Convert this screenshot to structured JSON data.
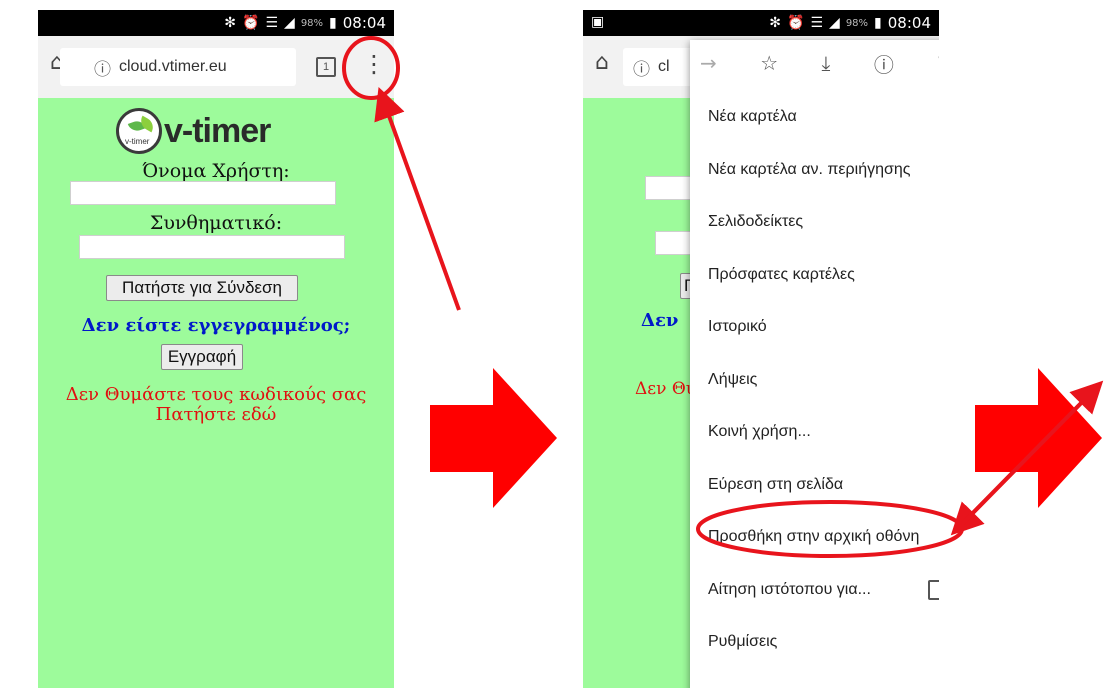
{
  "status_bar": {
    "battery_percent": "98%",
    "time": "08:04",
    "icons": [
      "bluetooth-icon",
      "alarm-icon",
      "wifi-icon",
      "signal-icon",
      "battery-icon"
    ]
  },
  "browser": {
    "url": "cloud.vtimer.eu",
    "url_fragment": "cl",
    "tab_count": "1"
  },
  "login_page": {
    "logo_text": "v-timer",
    "logo_mini_text": "v-timer",
    "username_label": "Όνομα Χρήστη:",
    "password_label": "Συνθηματικό:",
    "login_button": "Πατήστε για Σύνδεση",
    "not_registered": "Δεν είστε εγγεγραμμένος;",
    "register_button": "Εγγραφή",
    "forgot_line1": "Δεν Θυμάστε τους κωδικούς σας",
    "forgot_line2": "Πατήστε εδώ",
    "bg_fragment_button": "Γ",
    "bg_fragment_blue": "Δεν",
    "bg_fragment_red": "Δεν Θυ"
  },
  "chrome_menu": {
    "toolbar_icons": [
      "forward-icon",
      "star-icon",
      "download-icon",
      "info-icon",
      "reload-icon"
    ],
    "items": [
      "Νέα καρτέλα",
      "Νέα καρτέλα αν. περιήγησης",
      "Σελιδοδείκτες",
      "Πρόσφατες καρτέλες",
      "Ιστορικό",
      "Λήψεις",
      "Κοινή χρήση...",
      "Εύρεση στη σελίδα",
      "Προσθήκη στην αρχική οθόνη",
      "Αίτηση ιστότοπου για...",
      "Ρυθμίσεις"
    ],
    "highlighted_item": "Προσθήκη στην αρχική οθόνη"
  },
  "colors": {
    "page_bg": "#9dfb9b",
    "annotation_red": "#e8141c",
    "link_blue": "#0018c9",
    "text_red": "#e01010"
  }
}
